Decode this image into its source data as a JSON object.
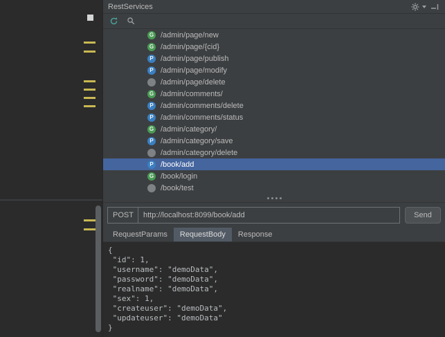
{
  "panel": {
    "title": "RestServices"
  },
  "endpoints": [
    {
      "type": "get",
      "letter": "G",
      "path": "/admin/page/new"
    },
    {
      "type": "get",
      "letter": "G",
      "path": "/admin/page/{cid}"
    },
    {
      "type": "post",
      "letter": "P",
      "path": "/admin/page/publish"
    },
    {
      "type": "post",
      "letter": "P",
      "path": "/admin/page/modify"
    },
    {
      "type": "other",
      "letter": "",
      "path": "/admin/page/delete"
    },
    {
      "type": "get",
      "letter": "G",
      "path": "/admin/comments/"
    },
    {
      "type": "post",
      "letter": "P",
      "path": "/admin/comments/delete"
    },
    {
      "type": "post",
      "letter": "P",
      "path": "/admin/comments/status"
    },
    {
      "type": "get",
      "letter": "G",
      "path": "/admin/category/"
    },
    {
      "type": "post",
      "letter": "P",
      "path": "/admin/category/save"
    },
    {
      "type": "other",
      "letter": "",
      "path": "/admin/category/delete"
    },
    {
      "type": "post",
      "letter": "P",
      "path": "/book/add",
      "selected": true
    },
    {
      "type": "get",
      "letter": "G",
      "path": "/book/login"
    },
    {
      "type": "other",
      "letter": "",
      "path": "/book/test"
    }
  ],
  "request": {
    "method": "POST",
    "url": "http://localhost:8099/book/add",
    "send_label": "Send",
    "body": "{\n \"id\": 1,\n \"username\": \"demoData\",\n \"password\": \"demoData\",\n \"realname\": \"demoData\",\n \"sex\": 1,\n \"createuser\": \"demoData\",\n \"updateuser\": \"demoData\"\n}"
  },
  "tabs": [
    {
      "label": "RequestParams",
      "selected": false
    },
    {
      "label": "RequestBody",
      "selected": true
    },
    {
      "label": "Response",
      "selected": false
    }
  ],
  "colors": {
    "get_badge": "#499C54",
    "post_badge": "#3A7FC2",
    "other_badge": "#7F8285",
    "row_selection": "#44659E",
    "refresh_accent": "#4AA5A0",
    "warning_stripe": "#C9B953"
  }
}
